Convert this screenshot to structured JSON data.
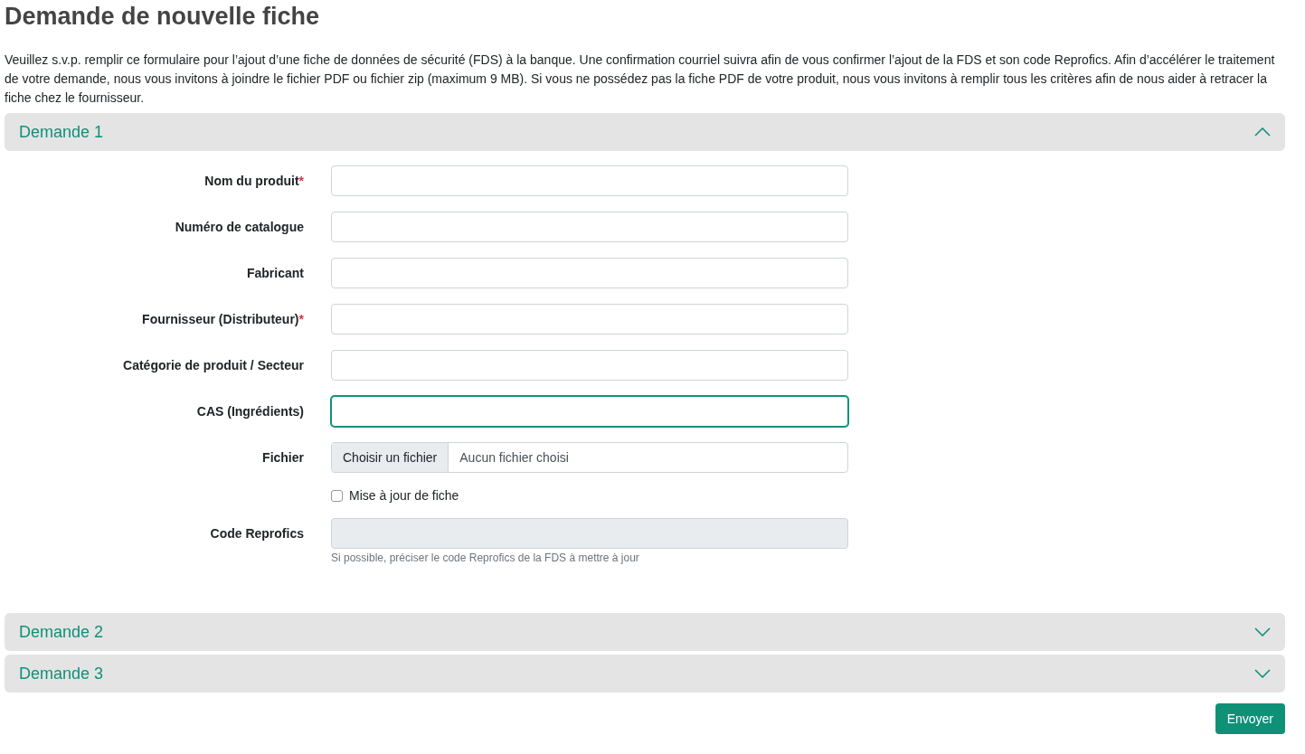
{
  "title": "Demande de nouvelle fiche",
  "intro": "Veuillez s.v.p. remplir ce formulaire pour l’ajout d’une fiche de données de sécurité (FDS) à la banque. Une confirmation courriel suivra afin de vous confirmer l’ajout de la FDS et son code Reprofics. Afin d’accélérer le traitement de votre demande, nous vous invitons à joindre le fichier PDF ou fichier zip (maximum 9 MB). Si vous ne possédez pas la fiche PDF de votre produit, nous vous invitons à remplir tous les critères afin de nous aider à retracer la fiche chez le fournisseur.",
  "sections": [
    {
      "title": "Demande 1",
      "expanded": true,
      "fields": [
        {
          "kind": "text",
          "label": "Nom du produit",
          "required_mark": "*"
        },
        {
          "kind": "text",
          "label": "Numéro de catalogue"
        },
        {
          "kind": "text",
          "label": "Fabricant"
        },
        {
          "kind": "text",
          "label": "Fournisseur (Distributeur)",
          "required_mark": "*"
        },
        {
          "kind": "text",
          "label": "Catégorie de produit / Secteur"
        },
        {
          "kind": "text",
          "label": "CAS (Ingrédients)",
          "focused": true
        },
        {
          "kind": "file",
          "label": "Fichier",
          "button": "Choisir un fichier",
          "status": "Aucun fichier choisi"
        },
        {
          "kind": "checkbox",
          "label": "Mise à jour de fiche",
          "checked": false
        },
        {
          "kind": "text",
          "label": "Code Reprofics",
          "disabled": true,
          "help": "Si possible, préciser le code Reprofics de la FDS à mettre à jour"
        }
      ]
    },
    {
      "title": "Demande 2",
      "expanded": false
    },
    {
      "title": "Demande 3",
      "expanded": false
    }
  ],
  "submit": "Envoyer"
}
